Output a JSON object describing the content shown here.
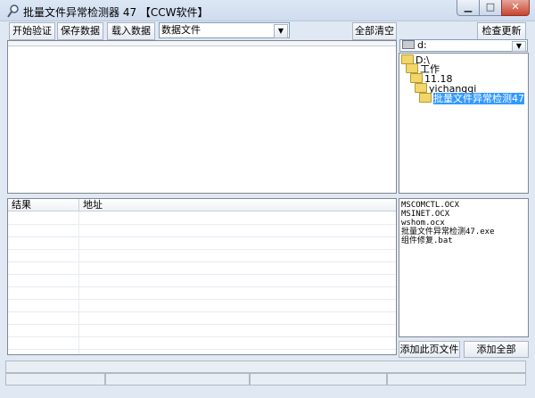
{
  "window": {
    "title": "批量文件异常检测器 47 【CCW软件】"
  },
  "toolbar": {
    "start_verify": "开始验证",
    "save_data": "保存数据",
    "load_data": "载入数据",
    "data_combo_value": "数据文件",
    "clear_all": "全部清空",
    "check_update": "检查更新"
  },
  "drive_combo": {
    "value": "d:"
  },
  "tree": {
    "items": [
      {
        "label": "D:\\"
      },
      {
        "label": "工作"
      },
      {
        "label": "11.18"
      },
      {
        "label": "yichangqi"
      },
      {
        "label": "批量文件异常检测47"
      }
    ]
  },
  "results_table": {
    "col_result": "结果",
    "col_address": "地址"
  },
  "file_list": {
    "items": [
      "MSCOMCTL.OCX",
      "MSINET.OCX",
      "wshom.ocx",
      "批量文件异常检测47.exe",
      "组件修复.bat"
    ]
  },
  "actions": {
    "add_page_files": "添加此页文件",
    "add_all": "添加全部"
  },
  "icons": {
    "app": "magnifier-icon",
    "minimize": "minimize-icon",
    "maximize": "maximize-icon",
    "close": "close-icon"
  }
}
